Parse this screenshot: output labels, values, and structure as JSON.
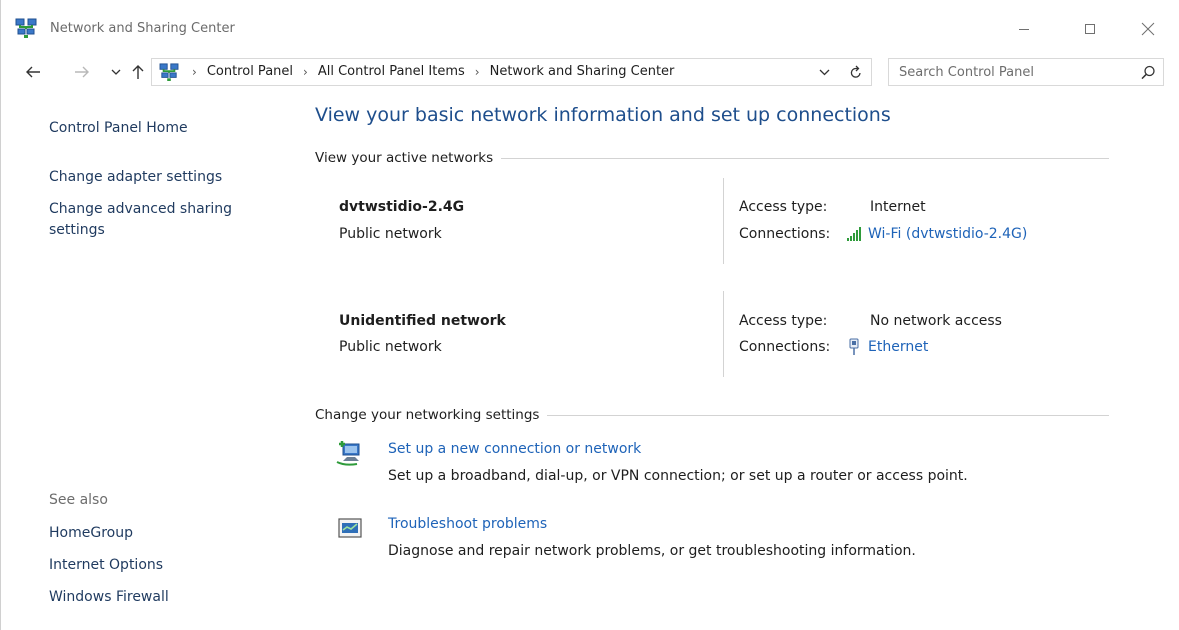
{
  "window": {
    "title": "Network and Sharing Center"
  },
  "address_bar": {
    "crumbs": [
      "Control Panel",
      "All Control Panel Items",
      "Network and Sharing Center"
    ],
    "search_placeholder": "Search Control Panel"
  },
  "left_pane": {
    "home": "Control Panel Home",
    "tasks": [
      "Change adapter settings",
      "Change advanced sharing settings"
    ],
    "see_also_label": "See also",
    "see_also": [
      "HomeGroup",
      "Internet Options",
      "Windows Firewall"
    ]
  },
  "main": {
    "heading": "View your basic network information and set up connections",
    "active_networks_label": "View your active networks",
    "networks": [
      {
        "name": "dvtwstidio-2.4G",
        "category": "Public network",
        "access_type_label": "Access type:",
        "access_type": "Internet",
        "connections_label": "Connections:",
        "connection": "Wi-Fi (dvtwstidio-2.4G)",
        "connection_icon": "wifi-signal-icon"
      },
      {
        "name": "Unidentified network",
        "category": "Public network",
        "access_type_label": "Access type:",
        "access_type": "No network access",
        "connections_label": "Connections:",
        "connection": "Ethernet",
        "connection_icon": "ethernet-icon"
      }
    ],
    "change_settings_label": "Change your networking settings",
    "tasks": [
      {
        "title": "Set up a new connection or network",
        "description": "Set up a broadband, dial-up, or VPN connection; or set up a router or access point.",
        "icon": "new-connection-icon"
      },
      {
        "title": "Troubleshoot problems",
        "description": "Diagnose and repair network problems, or get troubleshooting information.",
        "icon": "troubleshoot-icon"
      }
    ]
  },
  "colors": {
    "link": "#1e63b8",
    "heading": "#1e4e8c",
    "nav_link": "#1f3a5f",
    "muted": "#6d6d6d"
  }
}
